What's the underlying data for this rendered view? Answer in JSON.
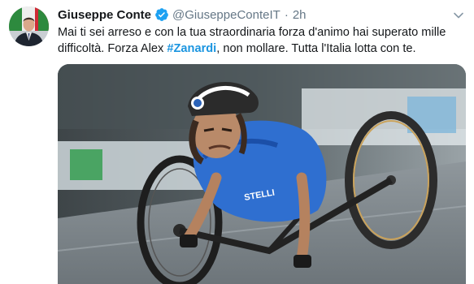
{
  "tweet": {
    "author_name": "Giuseppe Conte",
    "handle": "@GiuseppeConteIT",
    "separator": "·",
    "timestamp": "2h",
    "verified": true,
    "text_part1": "Mai ti sei arreso e con la tua straordinaria forza d'animo hai superato mille difficoltà. Forza Alex ",
    "hashtag": "#Zanardi",
    "text_part2": ", non mollare. Tutta l'Italia lotta con te."
  },
  "colors": {
    "text_primary": "#14171a",
    "text_secondary": "#657786",
    "link": "#1b95e0",
    "verified": "#1da1f2",
    "jersey": "#2f6fd0"
  },
  "icons": {
    "verified": "verified-badge-icon",
    "caret": "chevron-down-icon"
  },
  "media": {
    "jersey_brand": "STELLI"
  }
}
